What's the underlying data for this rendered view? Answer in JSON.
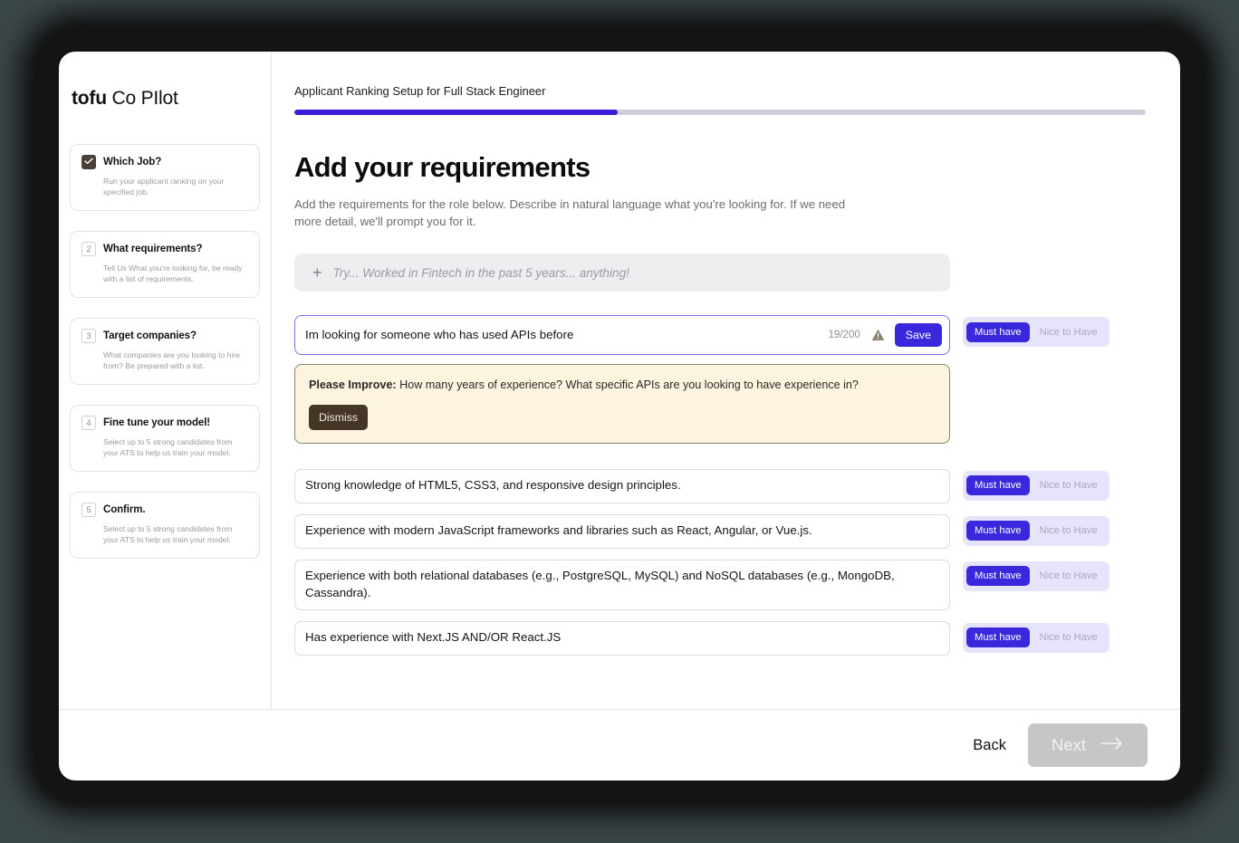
{
  "brand": {
    "bold": "tofu",
    "light": "Co PIlot"
  },
  "sidebar": {
    "steps": [
      {
        "badge": "✓",
        "checked": true,
        "title": "Which Job?",
        "desc": "Run your applicant ranking on your specified job."
      },
      {
        "badge": "2",
        "checked": false,
        "title": "What requirements?",
        "desc": "Tell Us What you're looking for, be ready with a list of requirements."
      },
      {
        "badge": "3",
        "checked": false,
        "title": "Target companies?",
        "desc": "What companies are you looking to hire from? Be prepared with a list."
      },
      {
        "badge": "4",
        "checked": false,
        "title": "Fine tune your model!",
        "desc": "Select up to 5 strong candidates from your ATS to help us train your model."
      },
      {
        "badge": "5",
        "checked": false,
        "title": "Confirm.",
        "desc": "Select up to 5 strong candidates from your ATS to help us train your model."
      }
    ]
  },
  "header": {
    "title": "Applicant Ranking Setup for Full Stack Engineer",
    "progress_percent": 38
  },
  "main": {
    "heading": "Add your requirements",
    "subheading": "Add the requirements for the role below. Describe in natural language what you're looking for. If we need more detail, we'll prompt you for it.",
    "add_box": {
      "icon": "plus-icon",
      "placeholder": "Try...  Worked in Fintech in the past 5 years... anything!"
    },
    "toggle": {
      "must_have": "Must have",
      "nice_to_have": "Nice to Have"
    },
    "active_requirement": {
      "value": "Im looking for someone who has used APIs before",
      "char_count": "19/200",
      "warning_icon": "warning-triangle-icon",
      "save_label": "Save",
      "selected": "Must have"
    },
    "improve": {
      "label": "Please Improve:",
      "message": "How many years of experience? What specific APIs are you looking to have experience in?",
      "dismiss_label": "Dismiss"
    },
    "requirements": [
      {
        "text": "Strong knowledge of HTML5, CSS3, and responsive design principles.",
        "selected": "Must have"
      },
      {
        "text": "Experience with modern JavaScript frameworks and libraries such as React, Angular, or Vue.js.",
        "selected": "Must have"
      },
      {
        "text": "Experience with both relational databases (e.g., PostgreSQL, MySQL) and NoSQL databases (e.g., MongoDB, Cassandra).",
        "selected": "Must have"
      },
      {
        "text": "Has experience with Next.JS AND/OR React.JS",
        "selected": "Must have"
      }
    ]
  },
  "footer": {
    "back_label": "Back",
    "next_label": "Next",
    "next_icon": "arrow-right-icon"
  },
  "colors": {
    "accent": "#3b28dd",
    "progress_fill": "#3b1edb",
    "toggle_bg": "#e6e4fb",
    "improve_bg": "#fdf4e0",
    "improve_border": "#8c7f6c",
    "dismiss_bg": "#453628",
    "next_disabled": "#c6c6c6",
    "page_bg": "#3c4749"
  }
}
